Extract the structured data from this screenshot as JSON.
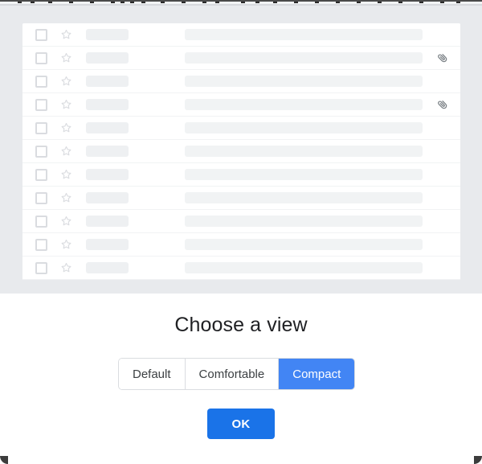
{
  "window": {
    "background_color": "#e8eaed",
    "panel_color": "#ffffff"
  },
  "message_list": {
    "name": "email-message-list",
    "columns": [
      "select",
      "star",
      "sender",
      "subject",
      "attachment"
    ],
    "rows": [
      {
        "checkbox": false,
        "starred": false,
        "sender": "",
        "subject": "",
        "has_attachment": false
      },
      {
        "checkbox": false,
        "starred": false,
        "sender": "",
        "subject": "",
        "has_attachment": true
      },
      {
        "checkbox": false,
        "starred": false,
        "sender": "",
        "subject": "",
        "has_attachment": false
      },
      {
        "checkbox": false,
        "starred": false,
        "sender": "",
        "subject": "",
        "has_attachment": true
      },
      {
        "checkbox": false,
        "starred": false,
        "sender": "",
        "subject": "",
        "has_attachment": false
      },
      {
        "checkbox": false,
        "starred": false,
        "sender": "",
        "subject": "",
        "has_attachment": false
      },
      {
        "checkbox": false,
        "starred": false,
        "sender": "",
        "subject": "",
        "has_attachment": false
      },
      {
        "checkbox": false,
        "starred": false,
        "sender": "",
        "subject": "",
        "has_attachment": false
      },
      {
        "checkbox": false,
        "starred": false,
        "sender": "",
        "subject": "",
        "has_attachment": false
      },
      {
        "checkbox": false,
        "starred": false,
        "sender": "",
        "subject": "",
        "has_attachment": false
      },
      {
        "checkbox": false,
        "starred": false,
        "sender": "",
        "subject": "",
        "has_attachment": false
      }
    ]
  },
  "dialog": {
    "title": "Choose a view",
    "density_options": [
      {
        "label": "Default",
        "selected": false
      },
      {
        "label": "Comfortable",
        "selected": false
      },
      {
        "label": "Compact",
        "selected": true
      }
    ],
    "selected_option": "Compact",
    "confirm_label": "OK",
    "accent_color": "#4285f4",
    "confirm_color": "#1a73e8"
  }
}
